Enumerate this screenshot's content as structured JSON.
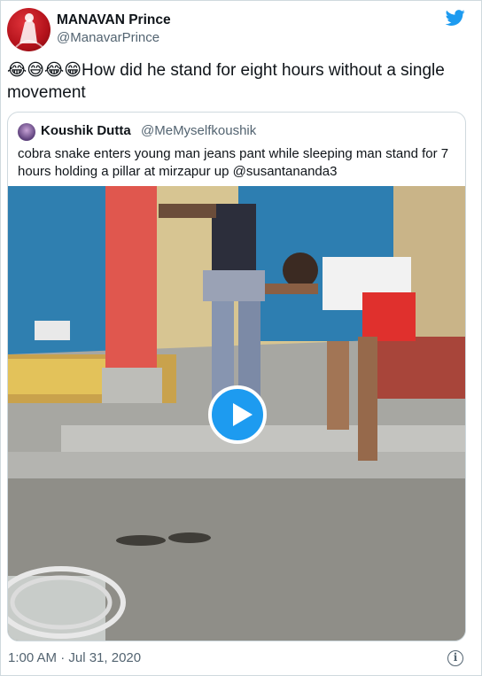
{
  "author": {
    "name": "MANAVAN Prince",
    "handle": "@ManavarPrince"
  },
  "tweet": {
    "emojis": "😂😅😂😁",
    "text": "How did he stand for eight hours without a single movement"
  },
  "quoted": {
    "name": "Koushik Dutta",
    "handle": "@MeMyselfkoushik",
    "text": "cobra snake enters young man jeans pant while sleeping man stand for 7 hours holding a pillar at mirzapur up @susantananda3"
  },
  "footer": {
    "timestamp": "1:00 AM · Jul 31, 2020",
    "info_glyph": "i"
  },
  "icons": {
    "brand": "twitter-bird-icon",
    "info": "info-icon",
    "play": "play-icon"
  },
  "colors": {
    "accent": "#1d9bf0",
    "secondary_text": "#536471",
    "border": "#cfd9de"
  }
}
